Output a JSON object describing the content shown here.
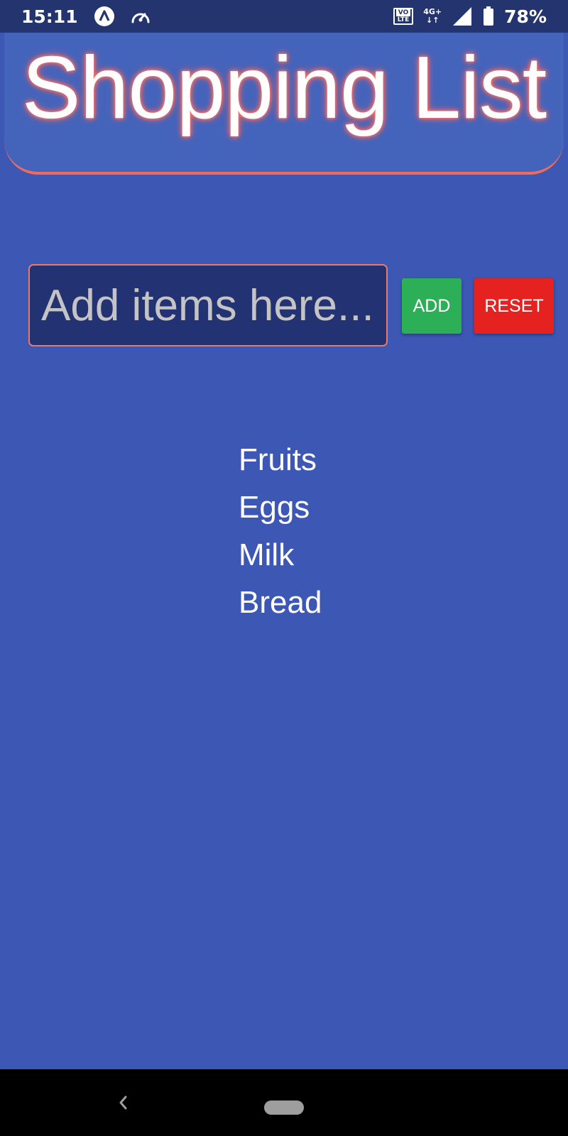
{
  "status_bar": {
    "time": "15:11",
    "volte_top": "VO",
    "volte_bottom": "LTE",
    "network_type": "4G+",
    "network_arrows": "↓↑",
    "battery_percent": "78%",
    "icons": [
      "app-notification-icon",
      "speed-gauge-icon",
      "volte-icon",
      "network-4g-icon",
      "signal-icon",
      "battery-icon"
    ]
  },
  "header": {
    "title": "Shopping List"
  },
  "form": {
    "input_value": "",
    "input_placeholder": "Add items here...",
    "add_label": "ADD",
    "reset_label": "RESET"
  },
  "list": {
    "items": [
      "Fruits",
      "Eggs",
      "Milk",
      "Bread"
    ]
  },
  "nav_bar": {
    "icons": [
      "back-icon",
      "home-pill-icon"
    ]
  },
  "colors": {
    "background": "#3c58b4",
    "status_bar": "#24346e",
    "header": "#4464bc",
    "header_accent": "#ef6b5c",
    "input_background": "#233273",
    "add_button": "#2daf58",
    "reset_button": "#e5221f"
  }
}
